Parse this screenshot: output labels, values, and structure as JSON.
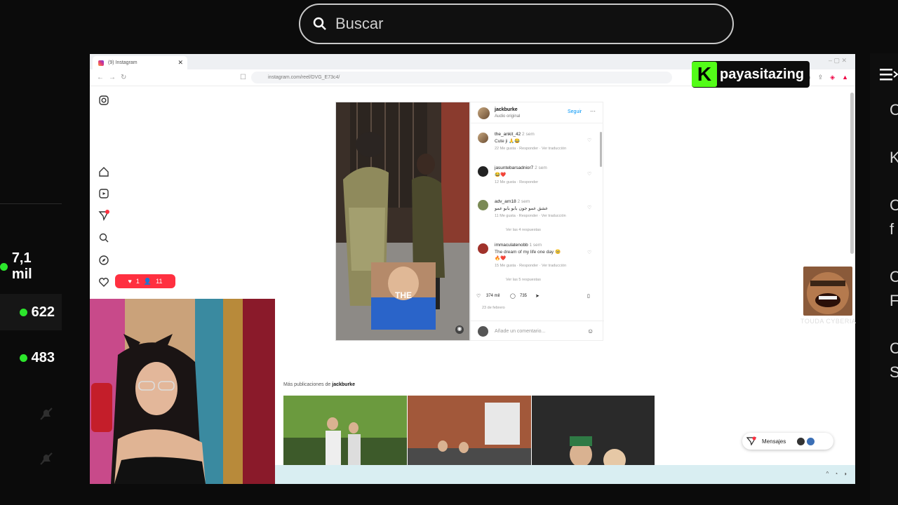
{
  "search": {
    "placeholder": "Buscar"
  },
  "viewers": [
    {
      "count": "7,1 mil"
    },
    {
      "count": "622"
    },
    {
      "count": "483"
    }
  ],
  "browser": {
    "tab_title": "(9) Instagram",
    "url": "instagram.com/reel/DVG_E73c4/"
  },
  "streamer": {
    "badge_letter": "K",
    "name": "payasitazing"
  },
  "instagram": {
    "notification": {
      "likes": "1",
      "follows": "11"
    },
    "post": {
      "username": "jackburke",
      "subtitle": "Audio original",
      "follow_label": "Seguir",
      "comments": [
        {
          "user": "the_ankit_42",
          "time": "2 sem",
          "text": "Cute ji 🙏😂",
          "likes": "22 Me gusta",
          "reply": "Responder",
          "translate": "Ver traducción"
        },
        {
          "user": "jasuntebarsadnior7",
          "time": "2 sem",
          "text": "😂❤️",
          "likes": "12 Me gusta",
          "reply": "Responder"
        },
        {
          "user": "adv_arn18",
          "time": "2 sem",
          "text": "عشق عمو جون بابو بابو عمو",
          "likes": "11 Me gusta",
          "reply": "Responder",
          "translate": "Ver traducción",
          "replies": "Ver las 4 respuestas"
        },
        {
          "user": "immaculatenobb",
          "time": "1 sem",
          "text": "The dream of my life one day 🥺",
          "text2": "🔥❤️",
          "likes": "15 Me gusta",
          "reply": "Responder",
          "translate": "Ver traducción",
          "replies": "Ver las 5 respuestas"
        }
      ],
      "like_count": "374 mil",
      "comment_count": "735",
      "date": "23 de febrero",
      "comment_placeholder": "Añade un comentario...",
      "sticker_word": "THE"
    },
    "more_posts_prefix": "Más publicaciones de",
    "more_posts_user": "jackburke",
    "messages_label": "Mensajes"
  },
  "overlay": {
    "caption": "TOUDA CYBERIA"
  },
  "right_letters": [
    "C",
    "",
    "",
    "K",
    "",
    "C",
    "f",
    "",
    "C",
    "F",
    "",
    "C",
    "S"
  ],
  "colors": {
    "kick_green": "#53fc18",
    "ig_blue": "#0095f6",
    "ig_red": "#ff3040",
    "online_dot": "#2ce62c"
  }
}
